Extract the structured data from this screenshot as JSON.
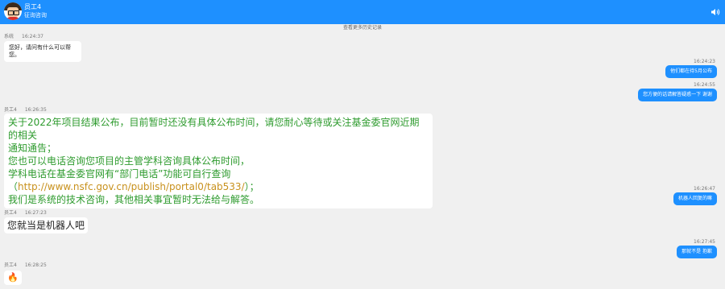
{
  "header": {
    "agent_name": "员工4",
    "status": "征询咨询"
  },
  "history_link": "查看更多历史记录",
  "messages": {
    "m1": {
      "sender": "系统",
      "time": "16:24:37",
      "text": "您好，请问有什么可以帮您。"
    },
    "m2": {
      "time": "16:24:23",
      "text": "他们都在待5月公布"
    },
    "m3": {
      "time": "16:24:55",
      "text": "您方便的话请解答疑惑一下 谢谢"
    },
    "m4": {
      "sender": "员工4",
      "time": "16:26:35",
      "line1": "关于2022年项目结果公布，目前暂时还没有具体公布时间，请您耐心等待或关注基金委官网近期的相关",
      "line2": "通知通告；",
      "line3": "您也可以电话咨询您项目的主管学科咨询具体公布时间，",
      "line4_pre": "学科电话在基金委官网有“部门电话”功能可自行查询（",
      "line4_link": "http://www.nsfc.gov.cn/publish/portal0/tab533/",
      "line4_post": "）；",
      "line5": "我们是系统的技术咨询，其他相关事宜暂时无法给与解答。"
    },
    "m5": {
      "time": "16:26:47",
      "text": "机器人回复的嘛"
    },
    "m6": {
      "sender": "员工4",
      "time": "16:27:23",
      "text": "您就当是机器人吧"
    },
    "m7": {
      "time": "16:27:45",
      "text": "那就不是 抱歉"
    },
    "m8": {
      "sender": "员工4",
      "time": "16:28:25",
      "emoji": "🔥"
    }
  }
}
